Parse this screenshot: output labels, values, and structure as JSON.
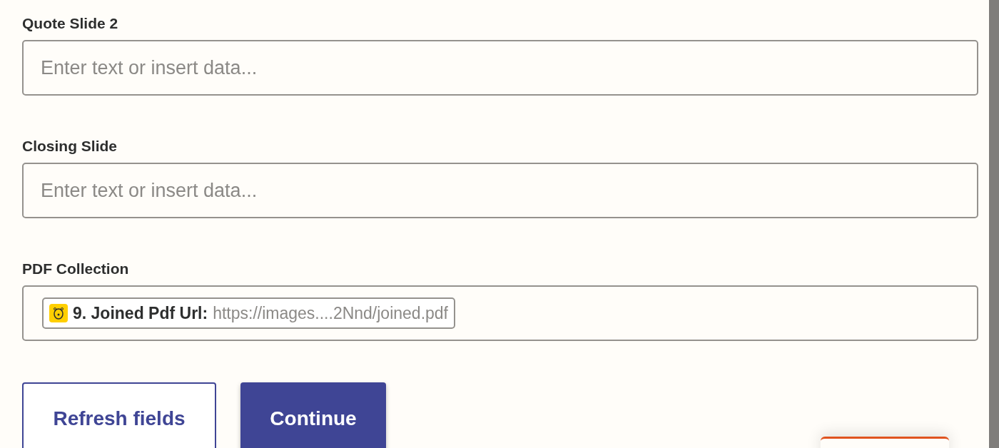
{
  "fields": [
    {
      "label": "Quote Slide 2",
      "placeholder": "Enter text or insert data..."
    },
    {
      "label": "Closing Slide",
      "placeholder": "Enter text or insert data..."
    },
    {
      "label": "PDF Collection",
      "pill": {
        "name": "9. Joined Pdf Url:",
        "value": "https://images....2Nnd/joined.pdf"
      }
    }
  ],
  "buttons": [
    {
      "label": "Refresh fields",
      "kind": "outline"
    },
    {
      "label": "Continue",
      "kind": "primary"
    }
  ]
}
